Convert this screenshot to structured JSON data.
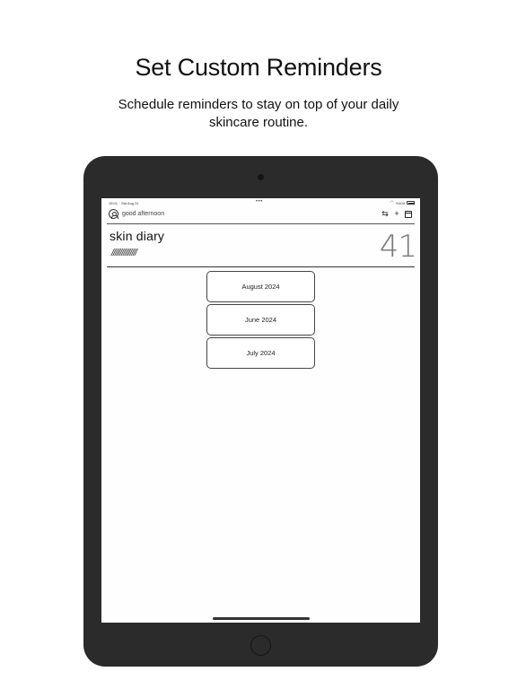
{
  "promo": {
    "headline": "Set Custom Reminders",
    "subline": "Schedule reminders to stay on top of your daily skincare routine."
  },
  "status_bar": {
    "time": "15:01",
    "date": "Sat Aug 31",
    "battery": "%100"
  },
  "header": {
    "greeting": "good afternoon",
    "icons": [
      "user-icon",
      "swap-icon",
      "plus-icon",
      "calendar-icon"
    ]
  },
  "diary": {
    "title": "skin diary",
    "hatch": "///////////////",
    "count": "41"
  },
  "months": [
    {
      "label": "August 2024"
    },
    {
      "label": "June 2024"
    },
    {
      "label": "July 2024"
    }
  ],
  "colors": {
    "device_frame": "#2b2b2b",
    "screen_background": "#fefefe",
    "text": "#111111"
  }
}
